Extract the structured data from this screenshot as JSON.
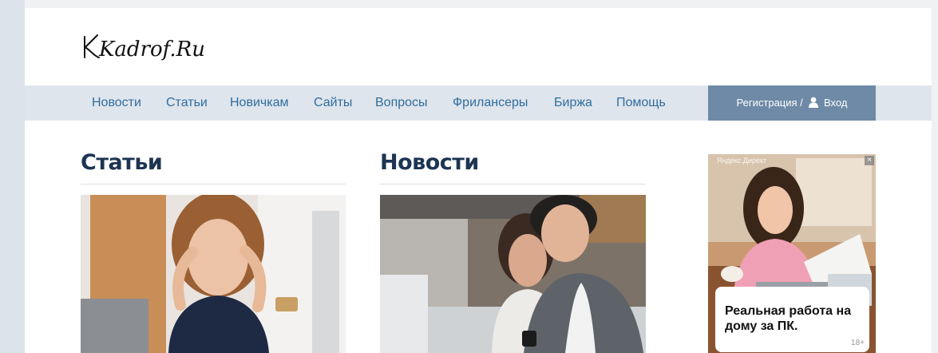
{
  "site": {
    "logo_text": "Kadrof.Ru"
  },
  "nav": {
    "items": [
      "Новости",
      "Статьи",
      "Новичкам",
      "Сайты",
      "Вопросы",
      "Фрилансеры",
      "Биржа",
      "Помощь"
    ],
    "register_label": "Регистрация /",
    "login_label": "Вход"
  },
  "sections": {
    "articles_title": "Статьи",
    "news_title": "Новости"
  },
  "ad": {
    "label": "Яндекс.Директ",
    "close": "×",
    "text": "Реальная работа на дому за ПК.",
    "age": "18+"
  },
  "colors": {
    "nav_bg": "#dfe5ec",
    "nav_link": "#2f6d9f",
    "auth_bg": "#6e8aa6",
    "title": "#1d3553"
  }
}
